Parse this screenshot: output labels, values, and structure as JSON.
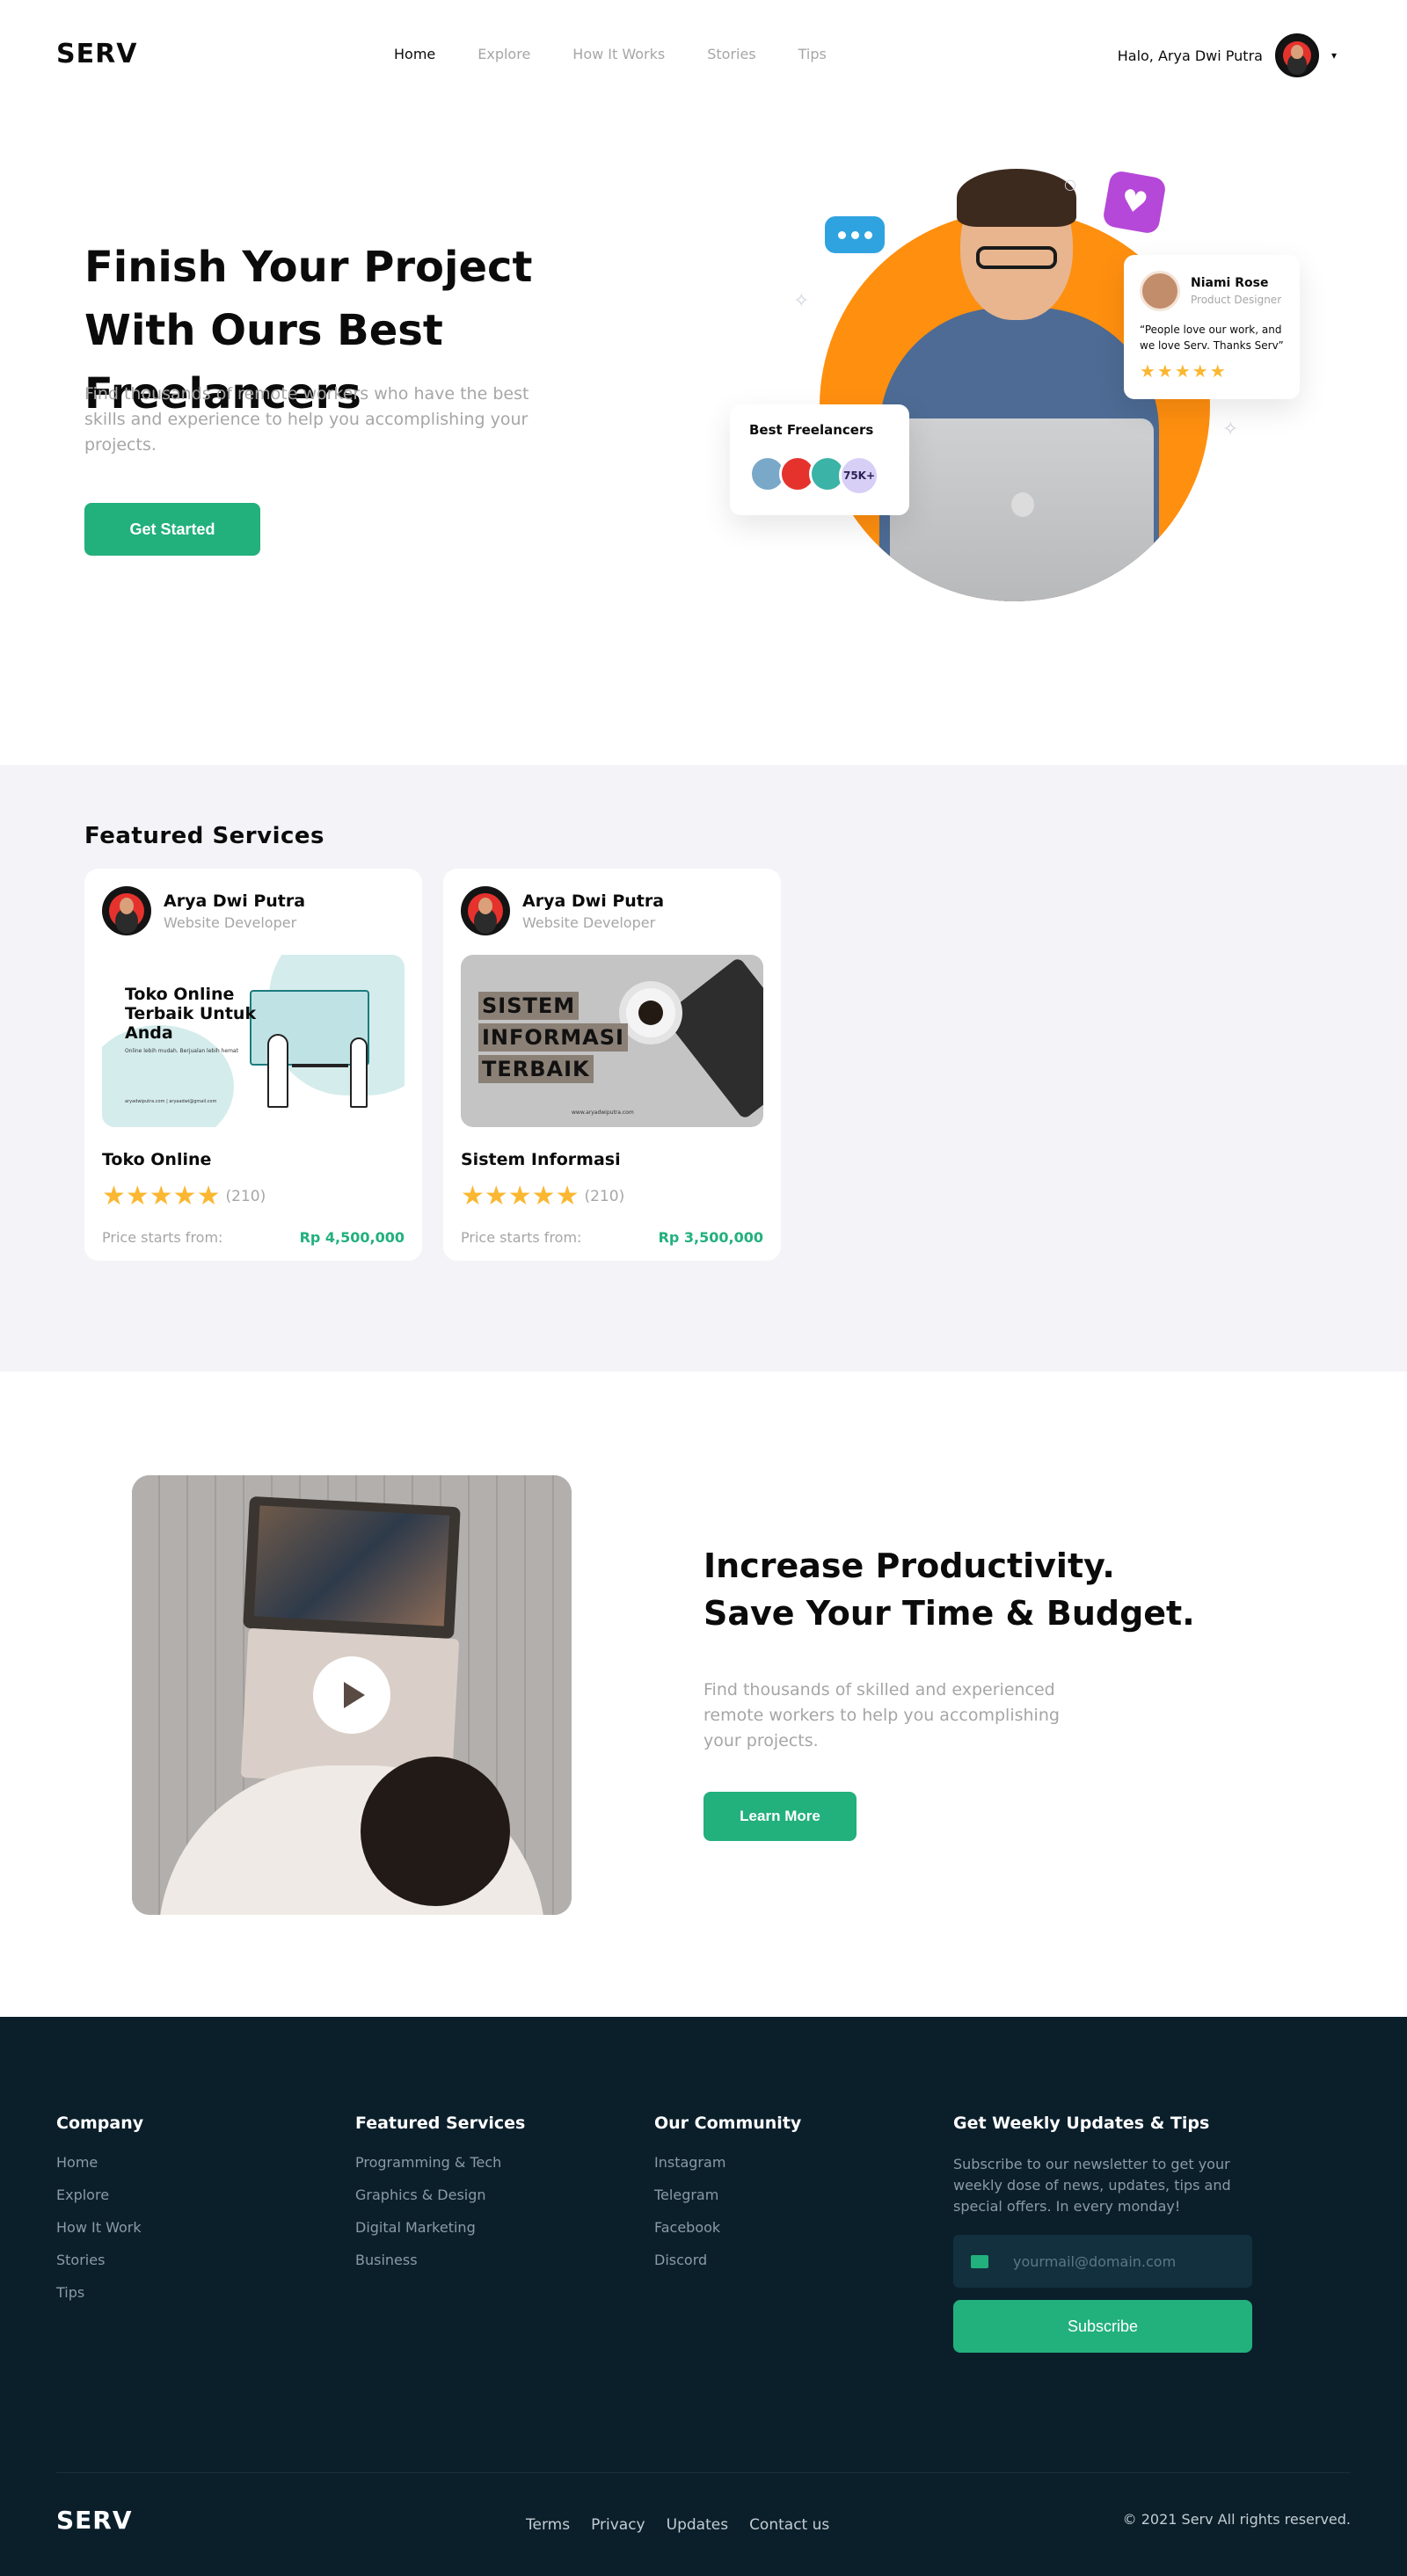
{
  "brand": "SERV",
  "nav": {
    "links": [
      "Home",
      "Explore",
      "How It Works",
      "Stories",
      "Tips"
    ],
    "active": "Home",
    "greeting": "Halo, Arya Dwi Putra"
  },
  "hero": {
    "title": "Finish Your Project With Ours Best Freelancers",
    "subtitle": "Find thousands of remote workers who have the best skills and experience to help you accomplishing your projects.",
    "cta": "Get Started",
    "best_freelancers_title": "Best Freelancers",
    "best_freelancers_count": "75K+",
    "testimonial": {
      "name": "Niami Rose",
      "role": "Product Designer",
      "quote": "“People love our work, and we love Serv. Thanks Serv”",
      "stars": "★★★★★"
    }
  },
  "featured": {
    "title": "Featured Services",
    "cards": [
      {
        "author": "Arya Dwi Putra",
        "role": "Website Developer",
        "image_title": "Toko Online Terbaik Untuk Anda",
        "image_small": "Online lebih mudah. Berjualan lebih hemat",
        "image_footer": "aryadwiputra.com | aryaadwi@gmail.com",
        "title": "Toko Online",
        "stars": "★★★★★",
        "rating_count": "(210)",
        "price_label": "Price starts from:",
        "price": "Rp 4,500,000"
      },
      {
        "author": "Arya Dwi Putra",
        "role": "Website Developer",
        "image_lines": [
          "SISTEM",
          "INFORMASI",
          "TERBAIK"
        ],
        "image_footer": "www.aryadwiputra.com",
        "title": "Sistem Informasi",
        "stars": "★★★★★",
        "rating_count": "(210)",
        "price_label": "Price starts from:",
        "price": "Rp 3,500,000"
      }
    ]
  },
  "productivity": {
    "title_line1": "Increase Productivity.",
    "title_line2": "Save Your Time & Budget.",
    "subtitle": "Find thousands of skilled and experienced remote workers to help you accomplishing your projects.",
    "cta": "Learn More"
  },
  "footer": {
    "company": {
      "heading": "Company",
      "links": [
        "Home",
        "Explore",
        "How It Work",
        "Stories",
        "Tips"
      ]
    },
    "services": {
      "heading": "Featured Services",
      "links": [
        "Programming & Tech",
        "Graphics & Design",
        "Digital Marketing",
        "Business"
      ]
    },
    "community": {
      "heading": "Our Community",
      "links": [
        "Instagram",
        "Telegram",
        "Facebook",
        "Discord"
      ]
    },
    "newsletter": {
      "heading": "Get Weekly Updates & Tips",
      "text": "Subscribe to our newsletter to get your weekly dose of news, updates, tips and special offers. In every monday!",
      "placeholder": "yourmail@domain.com",
      "button": "Subscribe"
    },
    "bottom_links": [
      "Terms",
      "Privacy",
      "Updates",
      "Contact us"
    ],
    "copyright": "© 2021 Serv All rights reserved."
  },
  "colors": {
    "accent_green": "#22b07d",
    "hero_orange": "#ff8f0f",
    "star_yellow": "#fbb731",
    "footer_bg": "#0b1f2b",
    "section_bg": "#f3f3f8"
  },
  "icons": [
    "avatar",
    "chevron-down-icon",
    "chat-bubble-icon",
    "heart-icon",
    "star-icon",
    "play-icon",
    "mail-icon"
  ]
}
